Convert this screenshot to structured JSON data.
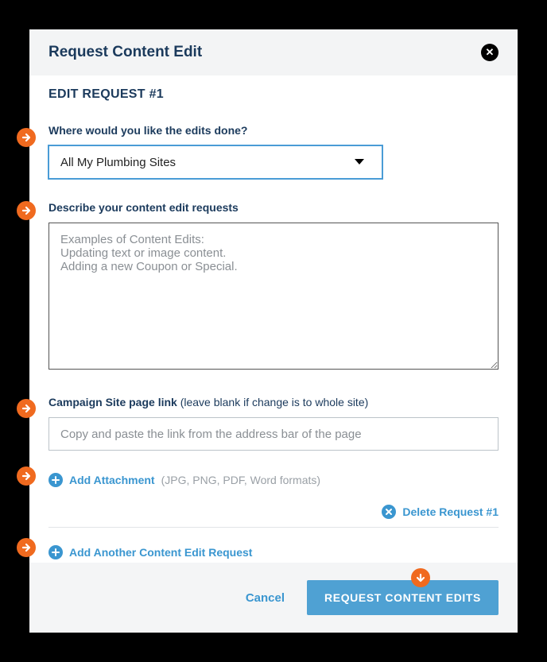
{
  "header": {
    "title": "Request Content Edit"
  },
  "editRequest": {
    "sectionTitle": "EDIT REQUEST #1",
    "whereLabel": "Where would you like the edits done?",
    "whereValue": "All My Plumbing Sites",
    "describeLabel": "Describe your content edit requests",
    "describePlaceholder": "Examples of Content Edits:\nUpdating text or image content.\nAdding a new Coupon or Special.",
    "pageLinkLabel": "Campaign Site page link ",
    "pageLinkHint": "(leave blank if change is to whole site)",
    "pageLinkPlaceholder": "Copy and paste the link from the address bar of the page",
    "addAttachmentLabel": "Add Attachment",
    "attachmentFormats": "(JPG, PNG, PDF, Word formats)",
    "deleteLabel": "Delete Request #1",
    "addAnotherLabel": "Add Another Content Edit Request"
  },
  "footer": {
    "cancel": "Cancel",
    "submit": "REQUEST CONTENT EDITS"
  }
}
